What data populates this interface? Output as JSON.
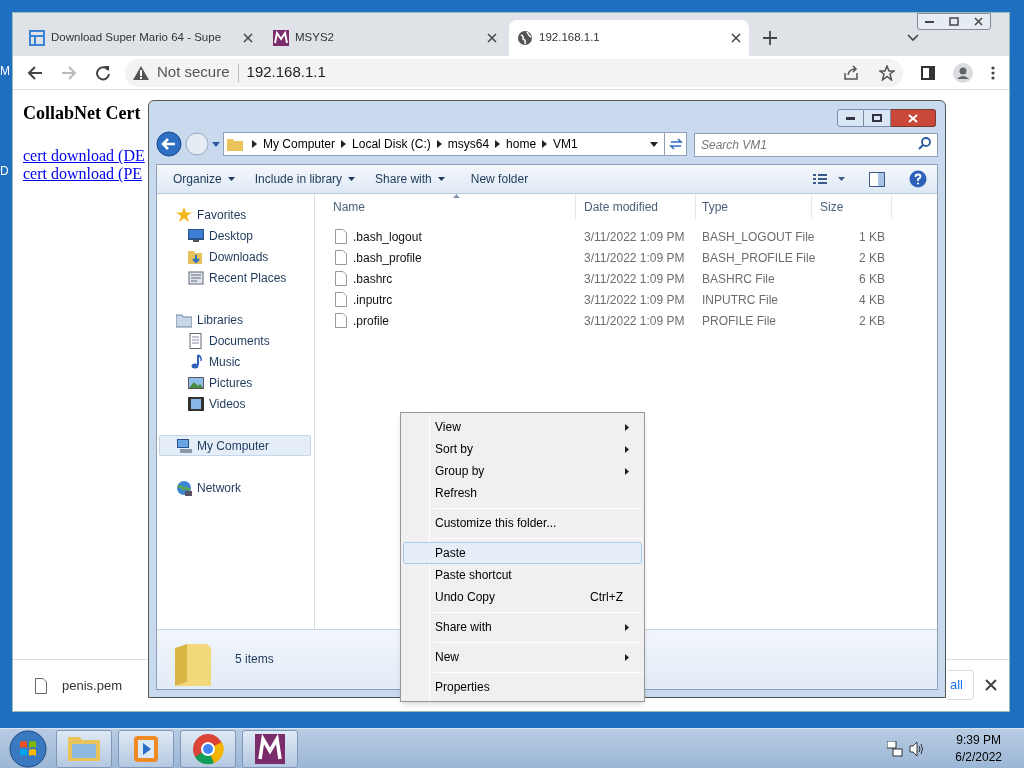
{
  "desktop": {
    "icon_labels": [
      "M",
      "D"
    ]
  },
  "browser": {
    "tabs": [
      {
        "title": "Download Super Mario 64 - Supe",
        "selected": false
      },
      {
        "title": "MSYS2",
        "selected": false
      },
      {
        "title": "192.168.1.1",
        "selected": true
      }
    ],
    "address": {
      "security": "Not secure",
      "url": "192.168.1.1"
    },
    "page": {
      "heading": "CollabNet Cert",
      "links": [
        "cert download (DE",
        "cert download (PE"
      ]
    },
    "download_bar": {
      "file": "penis.pem",
      "show_all": "all"
    }
  },
  "explorer": {
    "breadcrumb": [
      "My Computer",
      "Local Disk (C:)",
      "msys64",
      "home",
      "VM1"
    ],
    "search": {
      "placeholder": "Search VM1"
    },
    "toolbar": [
      "Organize",
      "Include in library",
      "Share with",
      "New folder"
    ],
    "nav": [
      {
        "label": "Favorites",
        "selected": false,
        "children": [
          {
            "label": "Desktop",
            "selected": false
          },
          {
            "label": "Downloads",
            "selected": false
          },
          {
            "label": "Recent Places",
            "selected": false
          }
        ]
      },
      {
        "label": "Libraries",
        "selected": false,
        "children": [
          {
            "label": "Documents",
            "selected": false
          },
          {
            "label": "Music",
            "selected": false
          },
          {
            "label": "Pictures",
            "selected": false
          },
          {
            "label": "Videos",
            "selected": false
          }
        ]
      },
      {
        "label": "My Computer",
        "selected": true
      },
      {
        "label": "Network",
        "selected": false
      }
    ],
    "columns": [
      "Name",
      "Date modified",
      "Type",
      "Size"
    ],
    "rows": [
      {
        "name": ".bash_logout",
        "date": "3/11/2022 1:09 PM",
        "type": "BASH_LOGOUT File",
        "size": "1 KB"
      },
      {
        "name": ".bash_profile",
        "date": "3/11/2022 1:09 PM",
        "type": "BASH_PROFILE File",
        "size": "2 KB"
      },
      {
        "name": ".bashrc",
        "date": "3/11/2022 1:09 PM",
        "type": "BASHRC File",
        "size": "6 KB"
      },
      {
        "name": ".inputrc",
        "date": "3/11/2022 1:09 PM",
        "type": "INPUTRC File",
        "size": "4 KB"
      },
      {
        "name": ".profile",
        "date": "3/11/2022 1:09 PM",
        "type": "PROFILE File",
        "size": "2 KB"
      }
    ],
    "status": "5 items"
  },
  "context_menu": [
    {
      "kind": "item",
      "label": "View",
      "submenu": true,
      "selected": false
    },
    {
      "kind": "item",
      "label": "Sort by",
      "submenu": true,
      "selected": false
    },
    {
      "kind": "item",
      "label": "Group by",
      "submenu": true,
      "selected": false
    },
    {
      "kind": "item",
      "label": "Refresh",
      "submenu": false,
      "selected": false
    },
    {
      "kind": "separator"
    },
    {
      "kind": "item",
      "label": "Customize this folder...",
      "submenu": false,
      "selected": false
    },
    {
      "kind": "separator"
    },
    {
      "kind": "item",
      "label": "Paste",
      "submenu": false,
      "selected": true
    },
    {
      "kind": "item",
      "label": "Paste shortcut",
      "submenu": false,
      "selected": false
    },
    {
      "kind": "item",
      "label": "Undo Copy",
      "shortcut": "Ctrl+Z",
      "submenu": false,
      "selected": false
    },
    {
      "kind": "separator"
    },
    {
      "kind": "item",
      "label": "Share with",
      "submenu": true,
      "selected": false
    },
    {
      "kind": "separator"
    },
    {
      "kind": "item",
      "label": "New",
      "submenu": true,
      "selected": false
    },
    {
      "kind": "separator"
    },
    {
      "kind": "item",
      "label": "Properties",
      "submenu": false,
      "selected": false
    }
  ],
  "taskbar": {
    "time": "9:39 PM",
    "date": "6/2/2022"
  }
}
